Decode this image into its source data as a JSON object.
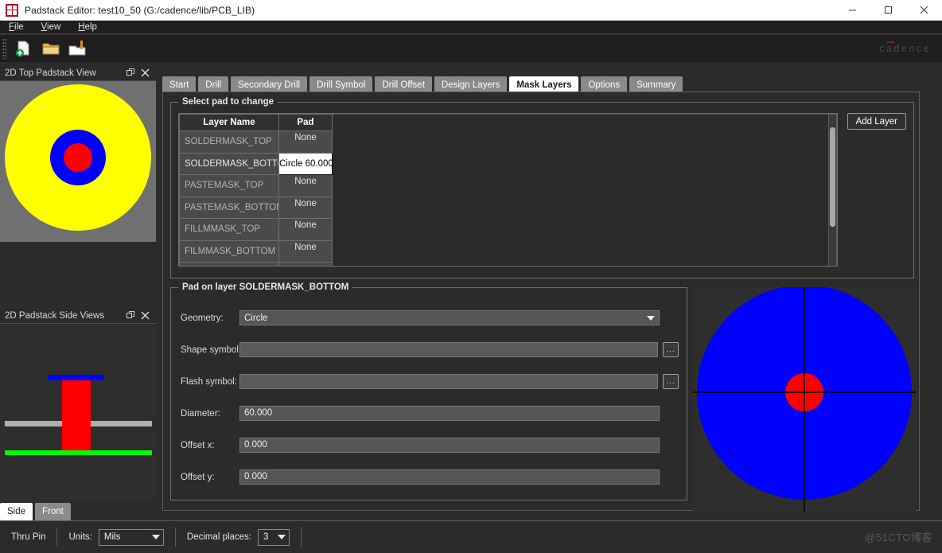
{
  "window": {
    "title": "Padstack Editor: test10_50  (G:/cadence/lib/PCB_LIB)",
    "app_icon": "padstack-app-icon",
    "minimize": "–",
    "maximize": "□",
    "close": "✕"
  },
  "menubar": {
    "items": [
      {
        "label": "File",
        "mnemonic": "F"
      },
      {
        "label": "View",
        "mnemonic": "V"
      },
      {
        "label": "Help",
        "mnemonic": "H"
      }
    ]
  },
  "toolbar": {
    "buttons": [
      {
        "name": "new-padstack",
        "icon": "new-document-icon"
      },
      {
        "name": "open-padstack",
        "icon": "open-folder-icon"
      },
      {
        "name": "save-padstack",
        "icon": "save-folder-icon"
      }
    ],
    "brand": "cadence"
  },
  "left_dock": {
    "top_panel": {
      "title": "2D Top Padstack View",
      "float_icon": "float-panel-icon",
      "close_icon": "close-panel-icon",
      "graphic": {
        "background": "#707070",
        "rings": [
          {
            "name": "soldermask-ring",
            "color": "#ffff00"
          },
          {
            "name": "pad-ring",
            "color": "#0000ff"
          },
          {
            "name": "drill-hole",
            "color": "#ff0000"
          }
        ]
      }
    },
    "side_panel": {
      "title": "2D Padstack Side Views",
      "float_icon": "float-panel-icon",
      "close_icon": "close-panel-icon",
      "graphic": {
        "background": "#2e2e2e",
        "elements": [
          {
            "name": "top-mask-bar",
            "color": "#0000ff"
          },
          {
            "name": "barrel",
            "color": "#ff0000"
          },
          {
            "name": "board-line",
            "color": "#b0b0b0"
          },
          {
            "name": "bottom-mask-bar",
            "color": "#00ff00"
          }
        ]
      },
      "tabs": [
        {
          "label": "Side",
          "active": true
        },
        {
          "label": "Front",
          "active": false
        }
      ]
    }
  },
  "main": {
    "tabs": [
      {
        "label": "Start",
        "active": false
      },
      {
        "label": "Drill",
        "active": false
      },
      {
        "label": "Secondary Drill",
        "active": false
      },
      {
        "label": "Drill Symbol",
        "active": false
      },
      {
        "label": "Drill Offset",
        "active": false
      },
      {
        "label": "Design Layers",
        "active": false
      },
      {
        "label": "Mask Layers",
        "active": true
      },
      {
        "label": "Options",
        "active": false
      },
      {
        "label": "Summary",
        "active": false
      }
    ],
    "select_pad_group": {
      "legend": "Select pad to change",
      "columns": [
        "Layer Name",
        "Pad"
      ],
      "rows": [
        {
          "layer": "SOLDERMASK_TOP",
          "pad": "None",
          "editing": false
        },
        {
          "layer": "SOLDERMASK_BOTTOM",
          "pad": "Circle 60.000",
          "editing": true
        },
        {
          "layer": "PASTEMASK_TOP",
          "pad": "None",
          "editing": false
        },
        {
          "layer": "PASTEMASK_BOTTOM",
          "pad": "None",
          "editing": false
        },
        {
          "layer": "FILLMMASK_TOP",
          "pad": "None",
          "editing": false
        },
        {
          "layer": "FILMMASK_BOTTOM",
          "pad": "None",
          "editing": false
        }
      ],
      "add_layer_button": "Add Layer"
    },
    "pad_group": {
      "legend": "Pad on layer SOLDERMASK_BOTTOM",
      "fields": [
        {
          "name": "geometry",
          "label": "Geometry:",
          "value": "Circle",
          "type": "combo"
        },
        {
          "name": "shape-symbol",
          "label": "Shape symbol:",
          "value": "",
          "type": "text-browse",
          "browse": "..."
        },
        {
          "name": "flash-symbol",
          "label": "Flash symbol:",
          "value": "",
          "type": "text-browse",
          "browse": "..."
        },
        {
          "name": "diameter",
          "label": "Diameter:",
          "value": "60.000",
          "type": "text"
        },
        {
          "name": "offset-x",
          "label": "Offset x:",
          "value": "0.000",
          "type": "text"
        },
        {
          "name": "offset-y",
          "label": "Offset y:",
          "value": "0.000",
          "type": "text"
        }
      ]
    },
    "preview": {
      "background": "#2e2e2e",
      "pad_color": "#0000ff",
      "hole_color": "#ff0000",
      "crosshair_color": "#000000"
    }
  },
  "statusbar": {
    "padstack_type": "Thru Pin",
    "units_label": "Units:",
    "units_value": "Mils",
    "decimal_label": "Decimal places:",
    "decimal_value": "3",
    "watermark": "@51CTO博客"
  }
}
